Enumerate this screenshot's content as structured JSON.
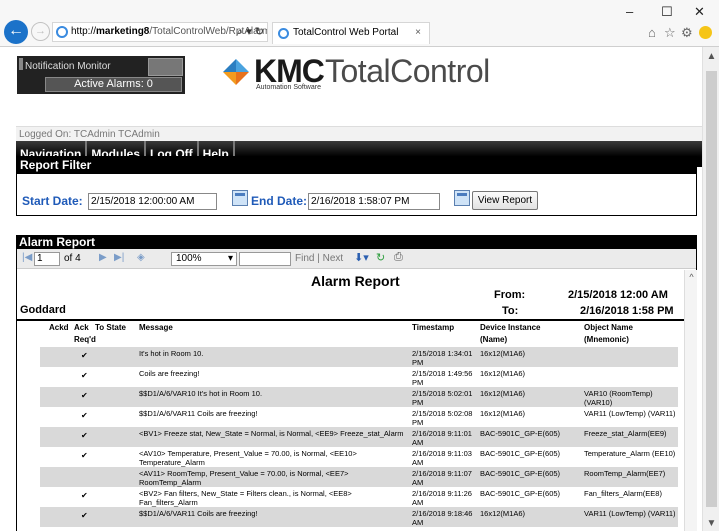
{
  "browser": {
    "url_host": "marketing8",
    "url_rest": "/TotalControlWeb/RptAlarm",
    "tab_title": "TotalControl Web Portal"
  },
  "header": {
    "notification_title": "Notification Monitor",
    "active_alarms": "Active Alarms: 0",
    "logo_kmc": "KMC",
    "logo_tc": "TotalControl",
    "logo_sub": "Automation Software",
    "logged_on": "Logged On: TCAdmin TCAdmin"
  },
  "nav": {
    "items": [
      "Navigation",
      "Modules",
      "Log Off",
      "Help"
    ]
  },
  "filter": {
    "title": "Report Filter",
    "start_label": "Start Date:",
    "start_value": "2/15/2018 12:00:00 AM",
    "end_label": "End Date:",
    "end_value": "2/16/2018 1:58:07 PM",
    "view_button": "View Report"
  },
  "report": {
    "section_title": "Alarm Report",
    "page": "1",
    "of_pages": "of 4",
    "zoom": "100%",
    "find": "Find",
    "next": "Next",
    "title": "Alarm Report",
    "site": "Goddard",
    "from_label": "From:",
    "to_label": "To:",
    "from_value": "2/15/2018 12:00 AM",
    "to_value": "2/16/2018 1:58 PM",
    "columns": {
      "ackd": "Ackd",
      "ack": "Ack Req'd",
      "to_state": "To State",
      "message": "Message",
      "timestamp": "Timestamp",
      "device": "Device Instance (Name)",
      "object": "Object Name (Mnemonic)"
    },
    "rows": [
      {
        "ack": "✔",
        "message": "It's hot in Room 10.",
        "timestamp": "2/15/2018 1:34:01 PM",
        "device": "16x12(M1A6)",
        "object": ""
      },
      {
        "ack": "✔",
        "message": "Coils are freezing!",
        "timestamp": "2/15/2018 1:49:56 PM",
        "device": "16x12(M1A6)",
        "object": ""
      },
      {
        "ack": "✔",
        "message": "$$D1/A/6/VAR10 It's hot in Room 10.",
        "timestamp": "2/15/2018 5:02:01 PM",
        "device": "16x12(M1A6)",
        "object": "VAR10 (RoomTemp) (VAR10)"
      },
      {
        "ack": "✔",
        "message": "$$D1/A/6/VAR11 Coils are freezing!",
        "timestamp": "2/15/2018 5:02:08 PM",
        "device": "16x12(M1A6)",
        "object": "VAR11 (LowTemp) (VAR11)"
      },
      {
        "ack": "✔",
        "message": "<BV1> Freeze stat, New_State = Normal, is Normal, <EE9> Freeze_stat_Alarm",
        "timestamp": "2/16/2018 9:11:01 AM",
        "device": "BAC-5901C_GP-E(605)",
        "object": "Freeze_stat_Alarm(EE9)"
      },
      {
        "ack": "✔",
        "message": "<AV10> Temperature, Present_Value = 70.00, is Normal, <EE10> Temperature_Alarm",
        "timestamp": "2/16/2018 9:11:03 AM",
        "device": "BAC-5901C_GP-E(605)",
        "object": "Temperature_Alarm (EE10)"
      },
      {
        "ack": "",
        "message": "<AV11> RoomTemp, Present_Value = 70.00, is Normal, <EE7> RoomTemp_Alarm",
        "timestamp": "2/16/2018 9:11:07 AM",
        "device": "BAC-5901C_GP-E(605)",
        "object": "RoomTemp_Alarm(EE7)"
      },
      {
        "ack": "✔",
        "message": "<BV2> Fan filters, New_State = Filters clean., is Normal, <EE8> Fan_filters_Alarm",
        "timestamp": "2/16/2018 9:11:26 AM",
        "device": "BAC-5901C_GP-E(605)",
        "object": "Fan_filters_Alarm(EE8)"
      },
      {
        "ack": "✔",
        "message": "$$D1/A/6/VAR11 Coils are freezing!",
        "timestamp": "2/16/2018 9:18:46 AM",
        "device": "16x12(M1A6)",
        "object": "VAR11 (LowTemp) (VAR11)"
      }
    ]
  }
}
